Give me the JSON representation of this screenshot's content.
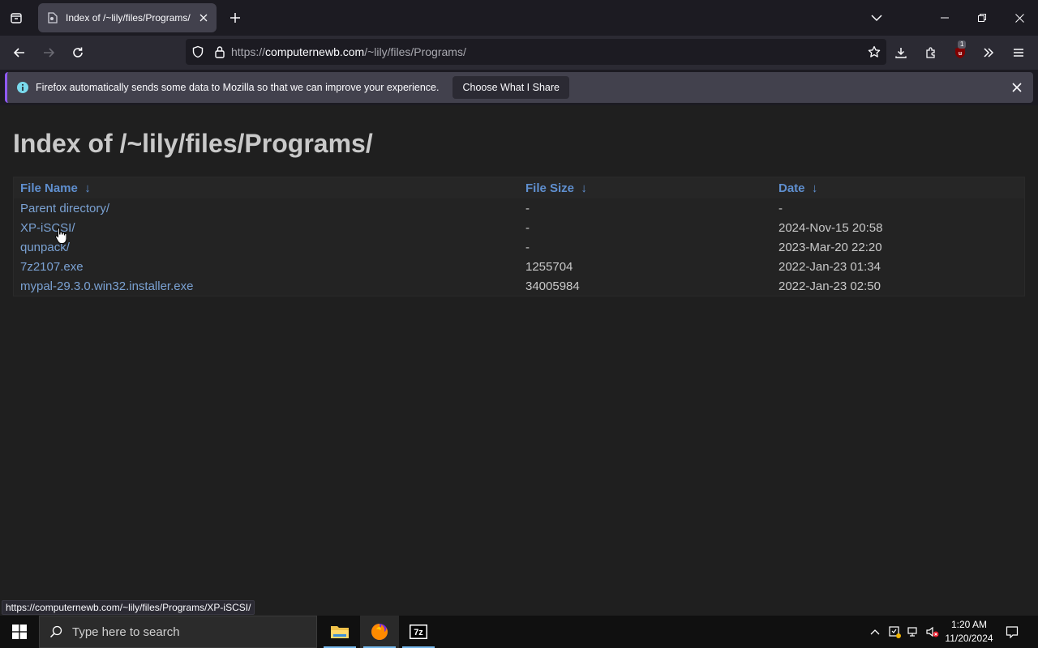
{
  "browser": {
    "tab": {
      "title": "Index of /~lily/files/Programs/"
    },
    "url": {
      "scheme": "https://",
      "host": "computernewb.com",
      "path": "/~lily/files/Programs/"
    },
    "ublock_badge": "1",
    "notification": {
      "message": "Firefox automatically sends some data to Mozilla so that we can improve your experience.",
      "button": "Choose What I Share"
    },
    "status_url": "https://computernewb.com/~lily/files/Programs/XP-iSCSI/"
  },
  "page": {
    "heading": "Index of /~lily/files/Programs/",
    "columns": [
      {
        "label": "File Name",
        "sort": "↓"
      },
      {
        "label": "File Size",
        "sort": "↓"
      },
      {
        "label": "Date",
        "sort": "↓"
      }
    ],
    "rows": [
      {
        "name": "Parent directory/",
        "size": "-",
        "date": "-"
      },
      {
        "name": "XP-iSCSI/",
        "size": "-",
        "date": "2024-Nov-15 20:58"
      },
      {
        "name": "qunpack/",
        "size": "-",
        "date": "2023-Mar-20 22:20"
      },
      {
        "name": "7z2107.exe",
        "size": "1255704",
        "date": "2022-Jan-23 01:34"
      },
      {
        "name": "mypal-29.3.0.win32.installer.exe",
        "size": "34005984",
        "date": "2022-Jan-23 02:50"
      }
    ]
  },
  "taskbar": {
    "search_placeholder": "Type here to search",
    "time": "1:20 AM",
    "date": "11/20/2024",
    "apps": [
      "file-explorer",
      "firefox",
      "7-zip"
    ],
    "sevenzip_label": "7z"
  },
  "colors": {
    "accent": "#9059ff",
    "link": "#7aa1d2",
    "header_link": "#5f8fcf"
  }
}
